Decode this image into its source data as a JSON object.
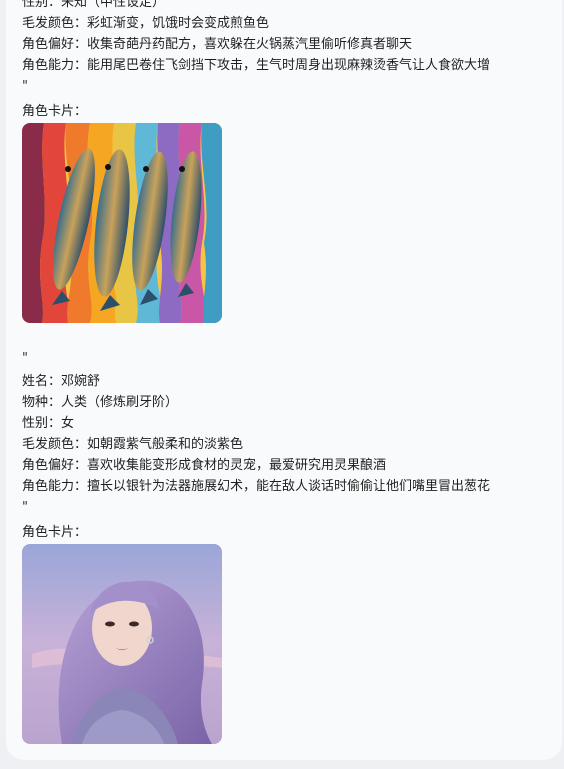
{
  "message": {
    "character1": {
      "gender": "性别：未知（中性设定）",
      "hair_color": "毛发颜色：彩虹渐变，饥饿时会变成煎鱼色",
      "preference": "角色偏好：收集奇葩丹药配方，喜欢躲在火锅蒸汽里偷听修真者聊天",
      "ability": "角色能力：能用尾巴卷住飞剑挡下攻击，生气时周身出现麻辣烫香气让人食欲大增",
      "quote_close": "\"",
      "card_label": "角色卡片："
    },
    "separator_quote": "\"",
    "character2": {
      "name": "姓名：邓婉舒",
      "species": "物种：人类（修炼刷牙阶）",
      "gender": "性别：女",
      "hair_color": "毛发颜色：如朝霞紫气般柔和的淡紫色",
      "preference": "角色偏好：喜欢收集能变形成食材的灵宠，最爱研究用灵果酿酒",
      "ability": "角色能力：擅长以银针为法器施展幻术，能在敌人谈话时偷偷让他们嘴里冒出葱花",
      "quote_close": "\"",
      "card_label": "角色卡片："
    }
  }
}
